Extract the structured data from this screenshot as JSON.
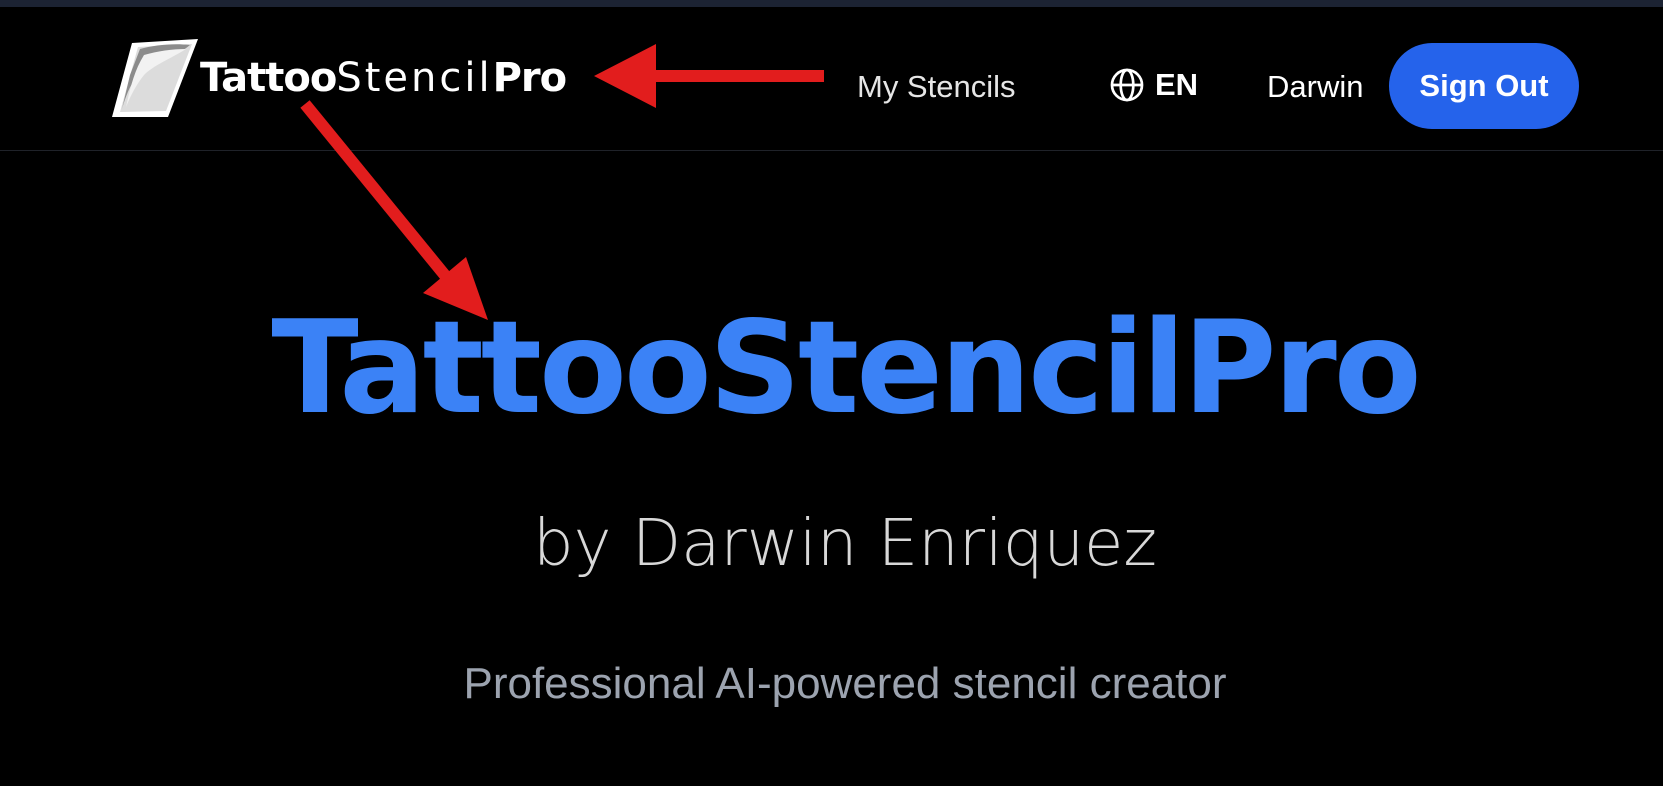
{
  "navbar": {
    "brand": {
      "part1": "Tattoo",
      "part2": "Stencil",
      "part3": "Pro",
      "logo_icon": "paper-brush-logo-icon"
    },
    "my_stencils": "My Stencils",
    "language": {
      "icon": "globe-icon",
      "code": "EN"
    },
    "user_name": "Darwin",
    "sign_out": "Sign Out"
  },
  "hero": {
    "title": "TattooStencilPro",
    "subtitle": "by Darwin Enriquez",
    "tagline": "Professional AI-powered stencil creator"
  },
  "colors": {
    "background": "#000000",
    "accent_blue": "#3b82f6",
    "button_blue": "#2563eb",
    "annotation_red": "#e21d1d",
    "tagline_gray": "#9ca3af"
  },
  "annotations": {
    "arrow_count": 2,
    "arrow_color": "#e21d1d"
  }
}
